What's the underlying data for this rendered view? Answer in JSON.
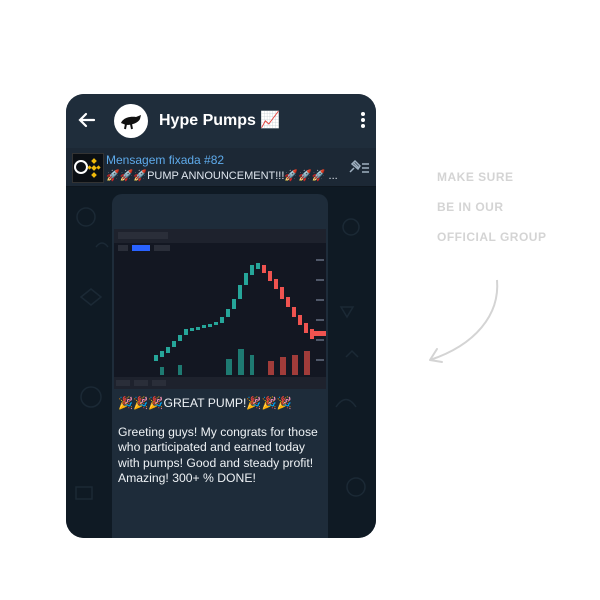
{
  "header": {
    "title": "Hype Pumps 📈"
  },
  "pinned": {
    "title": "Mensagem fixada #82",
    "text": "🚀🚀🚀PUMP ANNOUNCEMENT!!!🚀🚀🚀 ..."
  },
  "message": {
    "headline": "🎉🎉🎉GREAT PUMP!🎉🎉🎉",
    "body": "Greeting guys! My congrats for those who participated and earned today with pumps! Good and steady profit! Amazing! 300+ % DONE!"
  },
  "side_caption": {
    "line1": "MAKE SURE",
    "line2": "BE IN OUR",
    "line3": "OFFICIAL GROUP"
  },
  "colors": {
    "header_bg": "#1f2d3b",
    "chat_bg": "#0f1a24",
    "link_blue": "#5eaaea",
    "candle_up": "#26a69a",
    "candle_down": "#ef5350"
  },
  "icons": [
    "back-arrow-icon",
    "more-vertical-icon",
    "pin-icon",
    "channel-avatar-icon"
  ]
}
